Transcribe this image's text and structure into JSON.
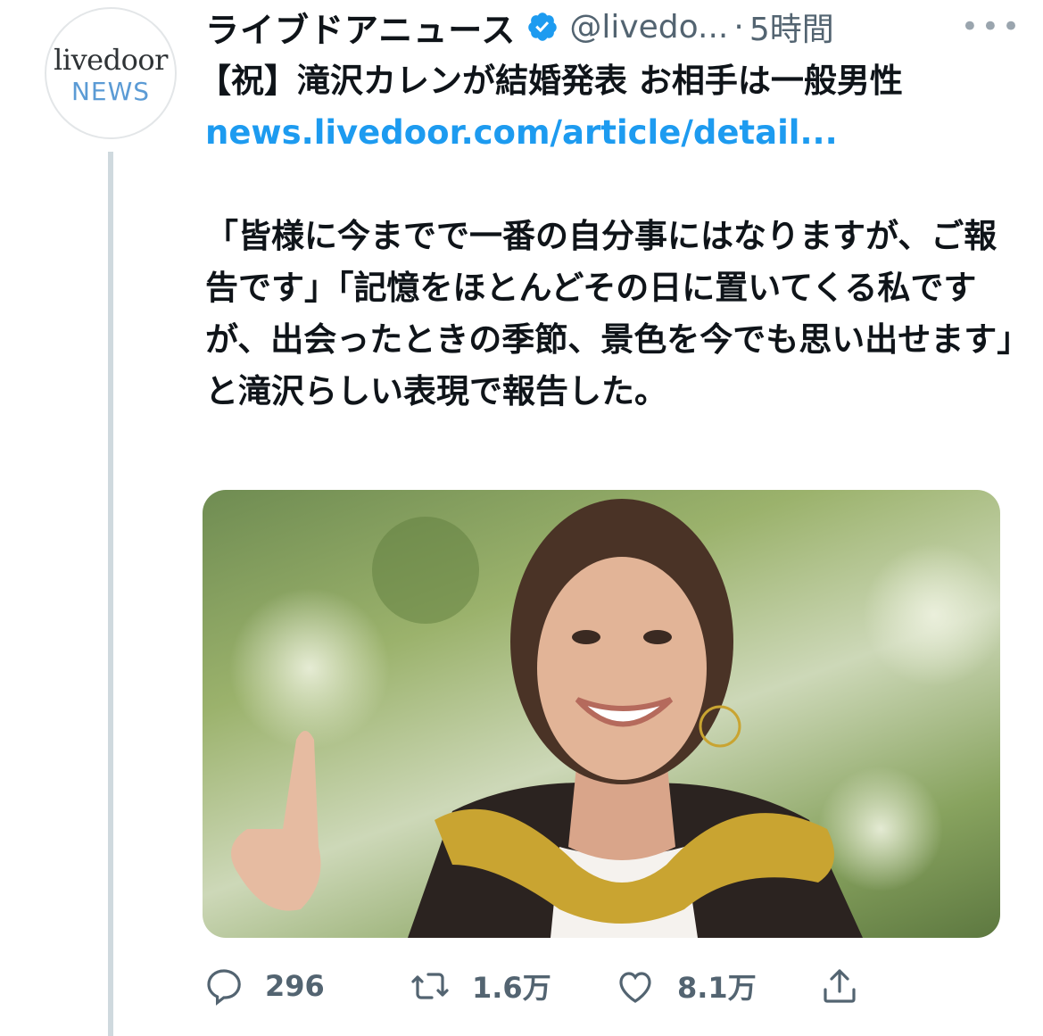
{
  "account": {
    "avatar_line1": "livedoor",
    "avatar_line2": "NEWS",
    "display_name": "ライブドアニュース",
    "handle": "@livedo...",
    "separator": "·",
    "time": "5時間"
  },
  "tweet": {
    "title": "【祝】滝沢カレンが結婚発表 お相手は一般男性",
    "link": "news.livedoor.com/article/detail...",
    "quote": "「皆様に今までで一番の自分事にはなりますが、ご報告です」「記憶をほとんどその日に置いてくる私ですが、出会ったときの季節、景色を今でも思い出せます」と滝沢らしい表現で報告した。"
  },
  "actions": {
    "reply_count": "296",
    "retweet_count": "1.6万",
    "like_count": "8.1万"
  },
  "colors": {
    "link": "#1d9bf0",
    "verified": "#1d9bf0",
    "muted": "#536471"
  },
  "icons": {
    "verified": "verified-badge-icon",
    "more": "more-icon",
    "reply": "reply-icon",
    "retweet": "retweet-icon",
    "like": "heart-icon",
    "share": "share-icon"
  }
}
